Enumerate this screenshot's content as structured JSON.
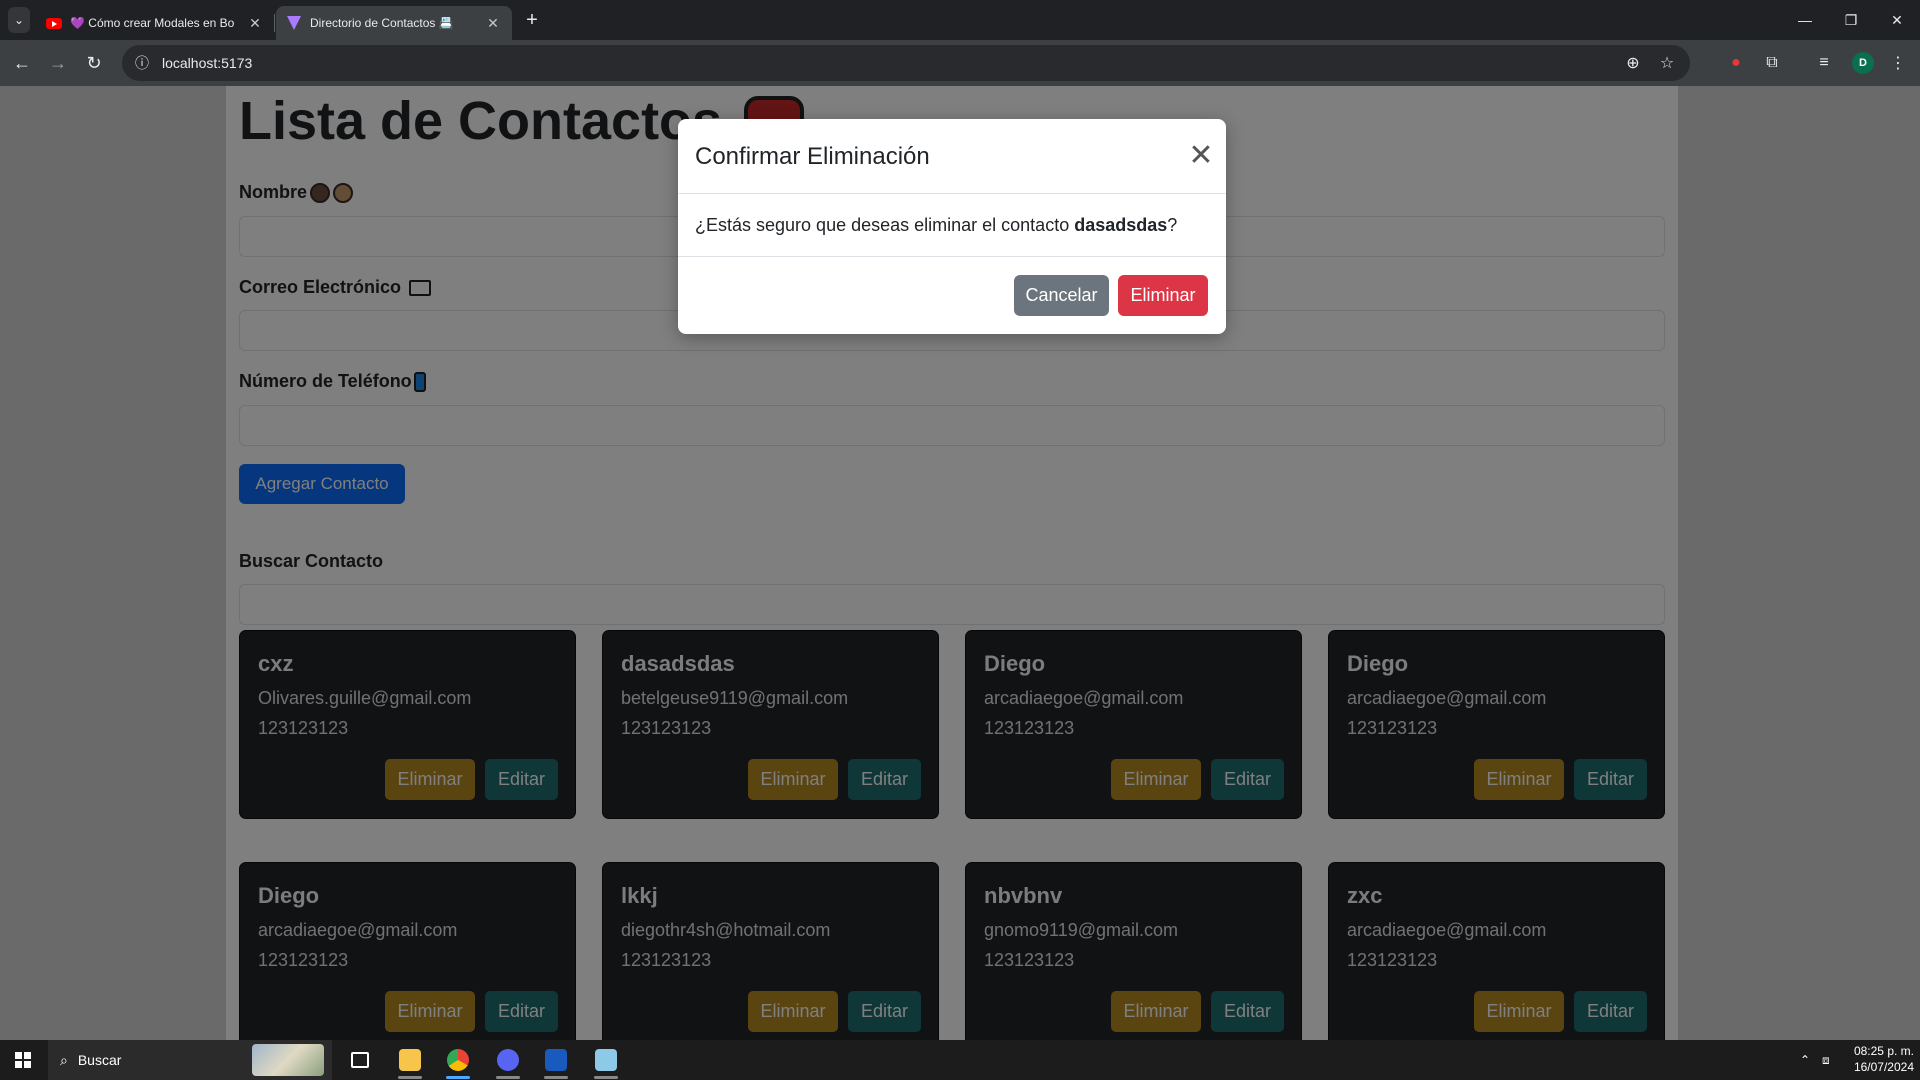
{
  "browser": {
    "tabs": [
      {
        "title": "💜 Cómo crear Modales en Bo",
        "active": false
      },
      {
        "title": "Directorio de Contactos 📇",
        "active": true
      }
    ],
    "url": "localhost:5173"
  },
  "page": {
    "title": "Lista de Contactos",
    "labels": {
      "name": "Nombre",
      "email": "Correo Electrónico",
      "phone": "Número de Teléfono",
      "search": "Buscar Contacto"
    },
    "add_button": "Agregar Contacto",
    "contacts": [
      {
        "name": "cxz",
        "email": "Olivares.guille@gmail.com",
        "phone": "123123123"
      },
      {
        "name": "dasadsdas",
        "email": "betelgeuse9119@gmail.com",
        "phone": "123123123"
      },
      {
        "name": "Diego",
        "email": "arcadiaegoe@gmail.com",
        "phone": "123123123"
      },
      {
        "name": "Diego",
        "email": "arcadiaegoe@gmail.com",
        "phone": "123123123"
      },
      {
        "name": "Diego",
        "email": "arcadiaegoe@gmail.com",
        "phone": "123123123"
      },
      {
        "name": "lkkj",
        "email": "diegothr4sh@hotmail.com",
        "phone": "123123123"
      },
      {
        "name": "nbvbnv",
        "email": "gnomo9119@gmail.com",
        "phone": "123123123"
      },
      {
        "name": "zxc",
        "email": "arcadiaegoe@gmail.com",
        "phone": "123123123"
      }
    ],
    "card_delete_label": "Eliminar",
    "card_edit_label": "Editar"
  },
  "modal": {
    "title": "Confirmar Eliminación",
    "body_prefix": "¿Estás seguro que deseas eliminar el contacto ",
    "contact_name": "dasadsdas",
    "body_suffix": "?",
    "cancel_label": "Cancelar",
    "delete_label": "Eliminar"
  },
  "taskbar": {
    "search_placeholder": "Buscar",
    "time": "08:25 p. m.",
    "date": "16/07/2024"
  },
  "colors": {
    "primary": "#0d6efd",
    "warning": "#b58a23",
    "edit": "#1f6f71",
    "danger": "#dc3545",
    "secondary": "#6c757d",
    "card_bg": "#212529"
  }
}
